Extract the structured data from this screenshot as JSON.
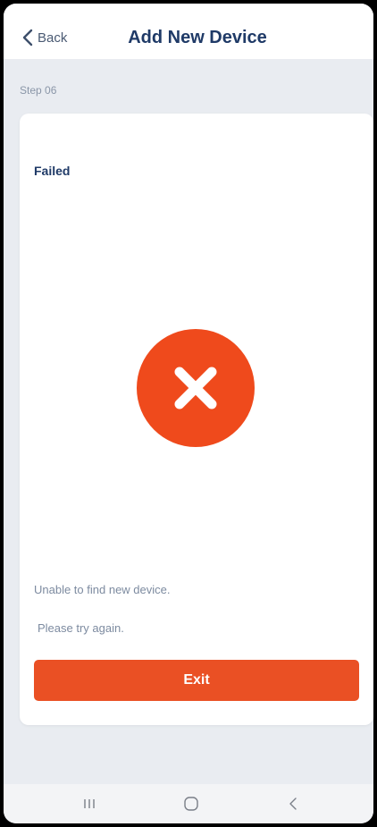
{
  "header": {
    "back_label": "Back",
    "title": "Add New Device"
  },
  "step": {
    "label": "Step 06"
  },
  "result": {
    "status": "Failed",
    "icon": "close-x-icon",
    "message_line1": "Unable to find new device.",
    "message_line2": "Please try again.",
    "exit_label": "Exit"
  },
  "nav": {
    "recents_icon": "recent-apps-icon",
    "home_icon": "home-icon",
    "back_icon": "back-icon"
  },
  "colors": {
    "accent": "#ea5024",
    "fail_circle": "#ef4a1c",
    "title": "#1f3a67",
    "background": "#e9ecf1"
  }
}
